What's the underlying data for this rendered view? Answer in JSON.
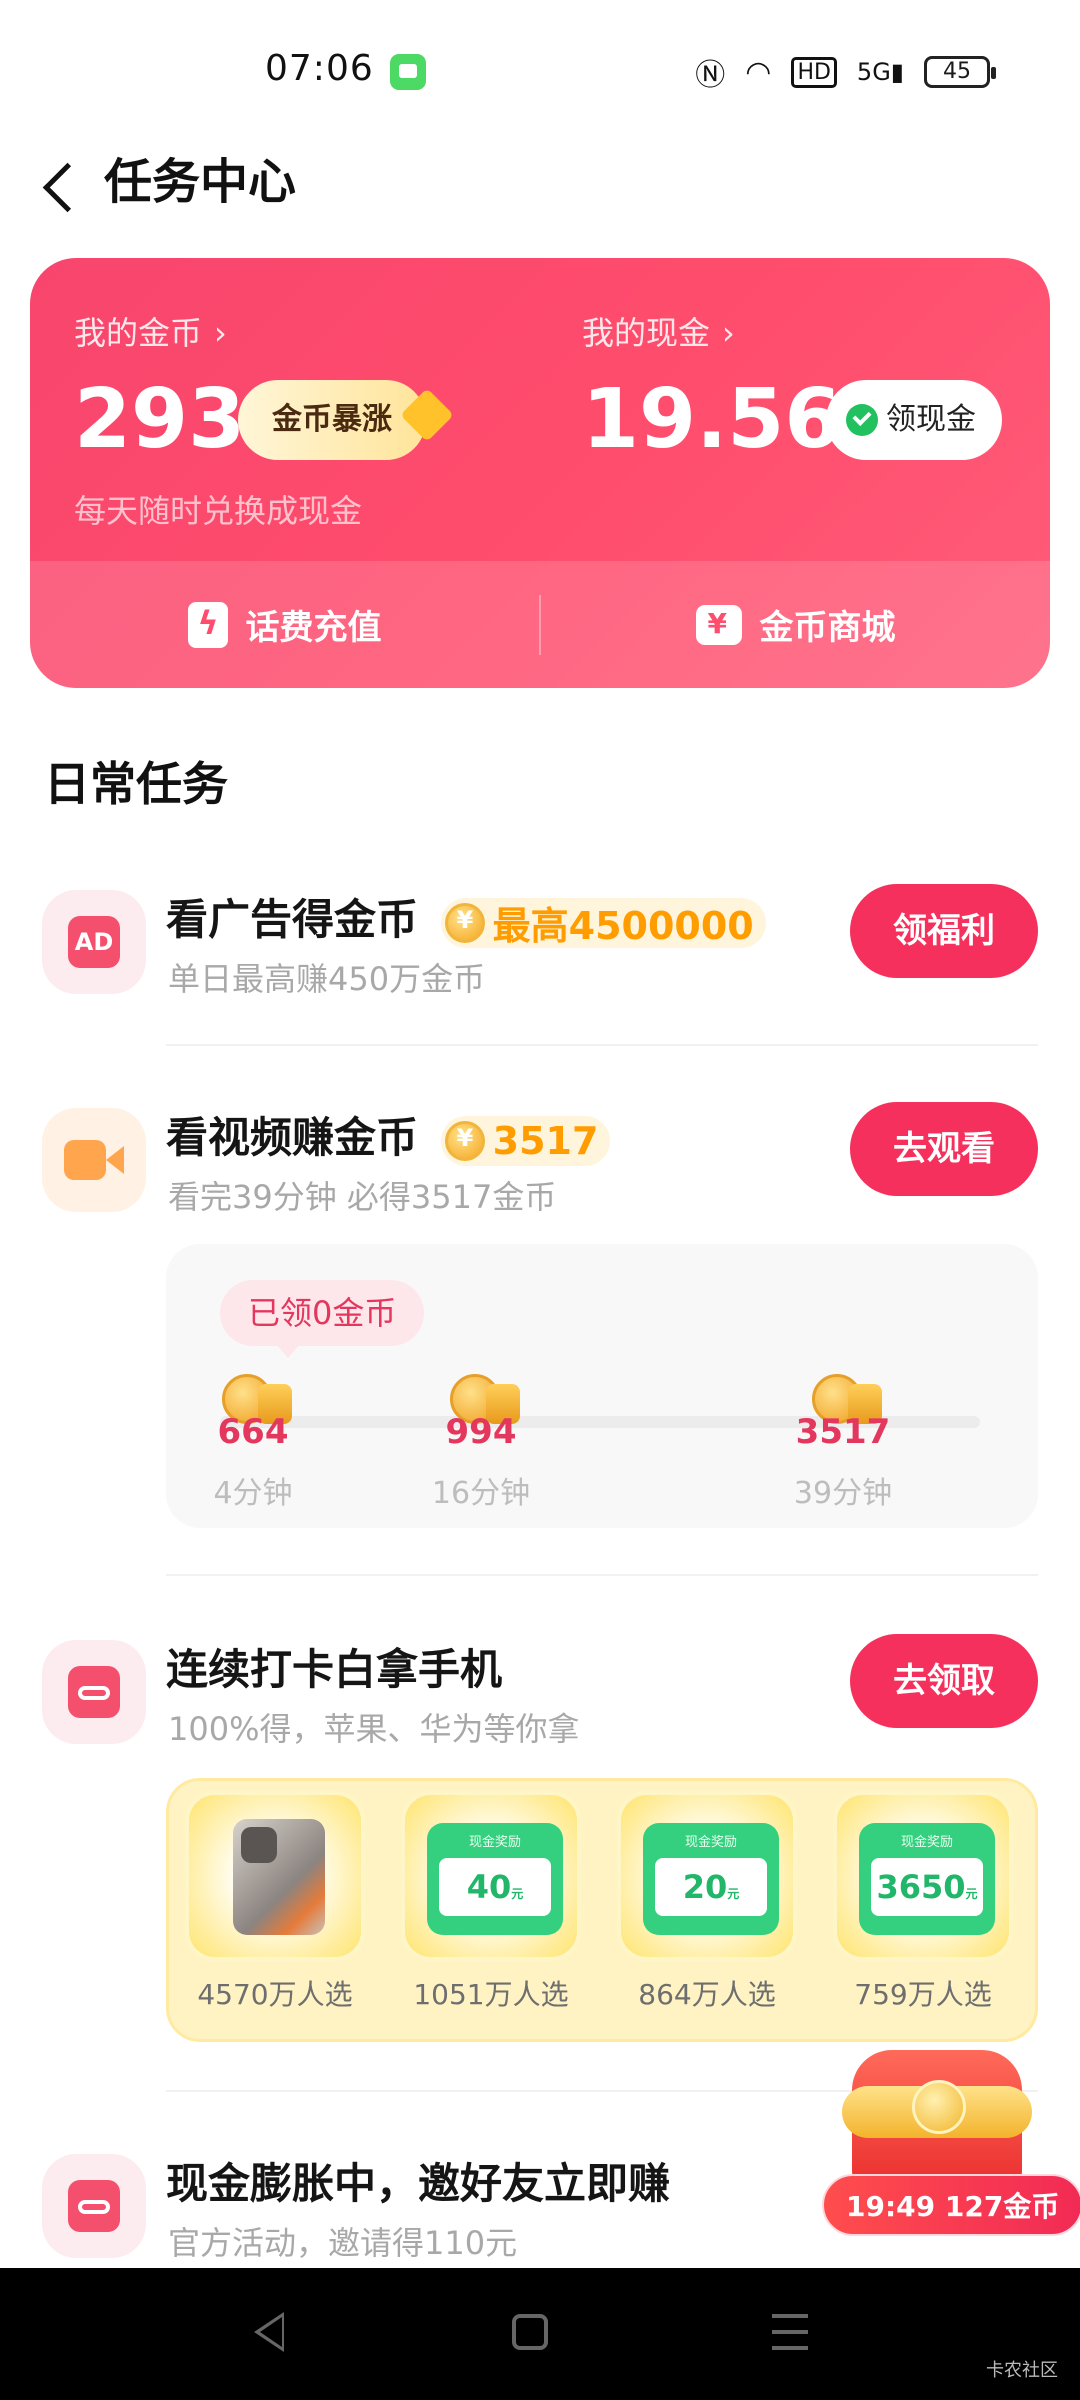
{
  "status_bar": {
    "time": "07:06",
    "battery": "45",
    "icons": [
      "message-icon",
      "nfc-icon",
      "wifi-icon",
      "hd-icon",
      "5g-signal-icon",
      "battery-icon"
    ]
  },
  "header": {
    "title": "任务中心",
    "back_icon": "chevron-left-icon"
  },
  "wallet": {
    "coins_label": "我的金币",
    "coins_value": "293",
    "coins_badge": "金币暴涨",
    "cash_label": "我的现金",
    "cash_value": "19.56",
    "cash_button": "领现金",
    "subtitle": "每天随时兑换成现金",
    "recharge_label": "话费充值",
    "store_label": "金币商城",
    "colors": {
      "card": "#ff4d6d",
      "accent": "#f5305c",
      "coin": "#ff9d00"
    }
  },
  "section_title": "日常任务",
  "tasks": [
    {
      "icon": "ad-icon",
      "title": "看广告得金币",
      "coin_tag": "最高4500000",
      "subtitle": "单日最高赚450万金币",
      "button": "领福利"
    },
    {
      "icon": "video-camera-icon",
      "title": "看视频赚金币",
      "coin_tag": "3517",
      "subtitle": "看完39分钟 必得3517金币",
      "button": "去观看"
    },
    {
      "icon": "checkin-calendar-icon",
      "title": "连续打卡白拿手机",
      "subtitle": "100%得，苹果、华为等你拿",
      "button": "去领取"
    },
    {
      "icon": "checkin-calendar-icon",
      "title": "现金膨胀中，邀好友立即赚",
      "subtitle": "官方活动，邀请得110元"
    }
  ],
  "video_progress": {
    "claimed": "已领0金币",
    "milestones": [
      {
        "coins": "664",
        "time": "4分钟"
      },
      {
        "coins": "994",
        "time": "16分钟"
      },
      {
        "coins": "3517",
        "time": "39分钟"
      }
    ]
  },
  "prizes": {
    "cash_caption": "现金奖励",
    "unit": "元",
    "items": [
      {
        "type": "phone",
        "label": "4570万人选"
      },
      {
        "type": "cash",
        "amount": "40",
        "label": "1051万人选"
      },
      {
        "type": "cash",
        "amount": "20",
        "label": "864万人选"
      },
      {
        "type": "cash",
        "amount": "3650",
        "label": "759万人选"
      }
    ]
  },
  "floating_reward": {
    "text": "19:49 127金币"
  },
  "watermark": "卡农社区"
}
